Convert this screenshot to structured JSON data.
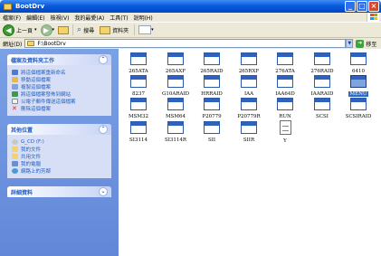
{
  "window": {
    "title": "BootDrv"
  },
  "menu": [
    "檔案(F)",
    "編輯(E)",
    "檢視(V)",
    "我的最愛(A)",
    "工具(T)",
    "說明(H)"
  ],
  "toolbar": {
    "back_label": "上一頁",
    "search_label": "搜尋",
    "folders_label": "資料夾"
  },
  "address": {
    "label": "網址(D)",
    "path": "F:\\BootDrv",
    "go_label": "移至"
  },
  "tasks_panel": {
    "title": "檔案及資料夾工作",
    "items": [
      "將這個檔案重新命名",
      "移動這個檔案",
      "複製這個檔案",
      "將這個檔案發佈到網站",
      "以電子郵件傳送這個檔案",
      "刪除這個檔案"
    ]
  },
  "other_places": {
    "title": "其他位置",
    "items": [
      "G_CD (F:)",
      "我的文件",
      "共用文件",
      "我的電腦",
      "網路上的芳鄰"
    ]
  },
  "details_panel": {
    "title": "詳細資料"
  },
  "files": [
    "265ATA",
    "265AXF",
    "265RAID",
    "265RXF",
    "276ATA",
    "276RAID",
    "6410",
    "8237",
    "G10ARAID",
    "HRRAID",
    "IAA",
    "IAA64D",
    "IAARAID",
    "MENU",
    "MSM32",
    "MSM64",
    "P20779",
    "P20779R",
    "RUN",
    "SCSI",
    "SCSIRAID",
    "SI3114",
    "SI3114R",
    "SII",
    "SIIR",
    "Y"
  ],
  "selected_file": "MENU"
}
